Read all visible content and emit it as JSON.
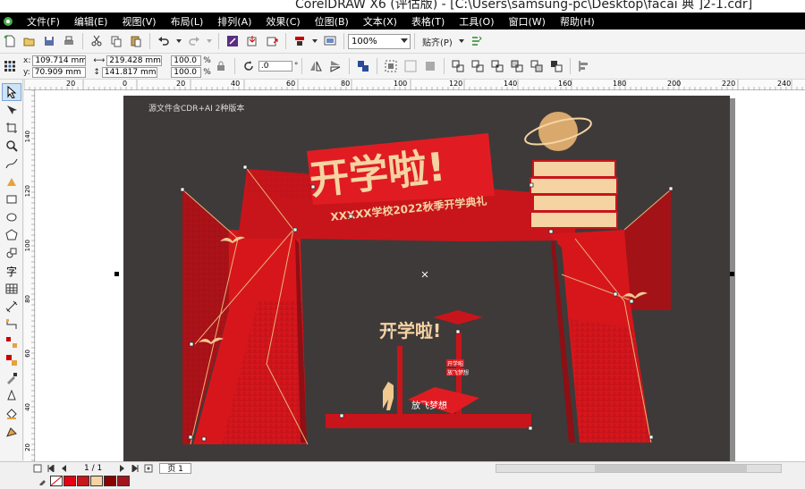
{
  "window": {
    "title": "CorelDRAW X6 (评估版) - [C:\\Users\\samsung-pc\\Desktop\\facai 典 ]2-1.cdr]"
  },
  "menu": [
    "文件(F)",
    "编辑(E)",
    "视图(V)",
    "布局(L)",
    "排列(A)",
    "效果(C)",
    "位图(B)",
    "文本(X)",
    "表格(T)",
    "工具(O)",
    "窗口(W)",
    "帮助(H)"
  ],
  "standard_toolbar": {
    "zoom": "100%",
    "snap_label": "贴齐(P)"
  },
  "property_bar": {
    "x": "109.714 mm",
    "y": "70.909 mm",
    "width": "219.428 mm",
    "height": "141.817 mm",
    "scale_x": "100.0",
    "scale_y": "100.0",
    "percent": "%",
    "rotation": ".0",
    "degree": "°"
  },
  "ruler": {
    "h_labels": [
      "20",
      "0",
      "20",
      "40",
      "60",
      "80",
      "100",
      "120",
      "140",
      "160",
      "180",
      "200",
      "220",
      "240"
    ],
    "v_labels": [
      "140",
      "120",
      "100",
      "80",
      "60",
      "40",
      "20",
      "0"
    ]
  },
  "artwork": {
    "watermark": "源文件含CDR+AI 2种版本",
    "main_title": "开学啦!",
    "subtitle": "XXXXX学校2022秋季开学典礼",
    "small_title": "开学啦!",
    "banner_text": "放飞梦想",
    "tag_1": "开学啦",
    "tag_2": "放飞梦想"
  },
  "page_nav": {
    "current": "1 / 1",
    "tab": "页 1"
  },
  "palette": [
    "#e60012",
    "#c8161d",
    "#f5d3a3",
    "#8b0000",
    "#a4141c"
  ],
  "colors": {
    "canvas": "#3e3a39",
    "accent_red": "#d7161c",
    "dark_red": "#9c0f16",
    "cream": "#f5d3a3",
    "gold": "#d9a86c"
  }
}
